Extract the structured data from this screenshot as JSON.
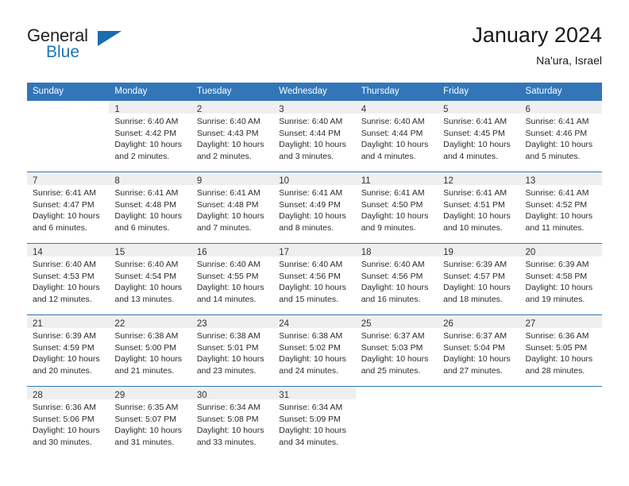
{
  "brand": {
    "name_part1": "General",
    "name_part2": "Blue",
    "flag_icon": "triangle-flag-icon"
  },
  "header": {
    "title": "January 2024",
    "location": "Na'ura, Israel"
  },
  "calendar": {
    "weekday_headers": [
      "Sunday",
      "Monday",
      "Tuesday",
      "Wednesday",
      "Thursday",
      "Friday",
      "Saturday"
    ],
    "header_bg": "#3276b8",
    "header_text_color": "#ffffff",
    "daynum_band_bg": "#efefef",
    "row_divider_color": "#3276b8",
    "weeks": [
      [
        {
          "day": "",
          "lines": []
        },
        {
          "day": "1",
          "lines": [
            "Sunrise: 6:40 AM",
            "Sunset: 4:42 PM",
            "Daylight: 10 hours",
            "and 2 minutes."
          ]
        },
        {
          "day": "2",
          "lines": [
            "Sunrise: 6:40 AM",
            "Sunset: 4:43 PM",
            "Daylight: 10 hours",
            "and 2 minutes."
          ]
        },
        {
          "day": "3",
          "lines": [
            "Sunrise: 6:40 AM",
            "Sunset: 4:44 PM",
            "Daylight: 10 hours",
            "and 3 minutes."
          ]
        },
        {
          "day": "4",
          "lines": [
            "Sunrise: 6:40 AM",
            "Sunset: 4:44 PM",
            "Daylight: 10 hours",
            "and 4 minutes."
          ]
        },
        {
          "day": "5",
          "lines": [
            "Sunrise: 6:41 AM",
            "Sunset: 4:45 PM",
            "Daylight: 10 hours",
            "and 4 minutes."
          ]
        },
        {
          "day": "6",
          "lines": [
            "Sunrise: 6:41 AM",
            "Sunset: 4:46 PM",
            "Daylight: 10 hours",
            "and 5 minutes."
          ]
        }
      ],
      [
        {
          "day": "7",
          "lines": [
            "Sunrise: 6:41 AM",
            "Sunset: 4:47 PM",
            "Daylight: 10 hours",
            "and 6 minutes."
          ]
        },
        {
          "day": "8",
          "lines": [
            "Sunrise: 6:41 AM",
            "Sunset: 4:48 PM",
            "Daylight: 10 hours",
            "and 6 minutes."
          ]
        },
        {
          "day": "9",
          "lines": [
            "Sunrise: 6:41 AM",
            "Sunset: 4:48 PM",
            "Daylight: 10 hours",
            "and 7 minutes."
          ]
        },
        {
          "day": "10",
          "lines": [
            "Sunrise: 6:41 AM",
            "Sunset: 4:49 PM",
            "Daylight: 10 hours",
            "and 8 minutes."
          ]
        },
        {
          "day": "11",
          "lines": [
            "Sunrise: 6:41 AM",
            "Sunset: 4:50 PM",
            "Daylight: 10 hours",
            "and 9 minutes."
          ]
        },
        {
          "day": "12",
          "lines": [
            "Sunrise: 6:41 AM",
            "Sunset: 4:51 PM",
            "Daylight: 10 hours",
            "and 10 minutes."
          ]
        },
        {
          "day": "13",
          "lines": [
            "Sunrise: 6:41 AM",
            "Sunset: 4:52 PM",
            "Daylight: 10 hours",
            "and 11 minutes."
          ]
        }
      ],
      [
        {
          "day": "14",
          "lines": [
            "Sunrise: 6:40 AM",
            "Sunset: 4:53 PM",
            "Daylight: 10 hours",
            "and 12 minutes."
          ]
        },
        {
          "day": "15",
          "lines": [
            "Sunrise: 6:40 AM",
            "Sunset: 4:54 PM",
            "Daylight: 10 hours",
            "and 13 minutes."
          ]
        },
        {
          "day": "16",
          "lines": [
            "Sunrise: 6:40 AM",
            "Sunset: 4:55 PM",
            "Daylight: 10 hours",
            "and 14 minutes."
          ]
        },
        {
          "day": "17",
          "lines": [
            "Sunrise: 6:40 AM",
            "Sunset: 4:56 PM",
            "Daylight: 10 hours",
            "and 15 minutes."
          ]
        },
        {
          "day": "18",
          "lines": [
            "Sunrise: 6:40 AM",
            "Sunset: 4:56 PM",
            "Daylight: 10 hours",
            "and 16 minutes."
          ]
        },
        {
          "day": "19",
          "lines": [
            "Sunrise: 6:39 AM",
            "Sunset: 4:57 PM",
            "Daylight: 10 hours",
            "and 18 minutes."
          ]
        },
        {
          "day": "20",
          "lines": [
            "Sunrise: 6:39 AM",
            "Sunset: 4:58 PM",
            "Daylight: 10 hours",
            "and 19 minutes."
          ]
        }
      ],
      [
        {
          "day": "21",
          "lines": [
            "Sunrise: 6:39 AM",
            "Sunset: 4:59 PM",
            "Daylight: 10 hours",
            "and 20 minutes."
          ]
        },
        {
          "day": "22",
          "lines": [
            "Sunrise: 6:38 AM",
            "Sunset: 5:00 PM",
            "Daylight: 10 hours",
            "and 21 minutes."
          ]
        },
        {
          "day": "23",
          "lines": [
            "Sunrise: 6:38 AM",
            "Sunset: 5:01 PM",
            "Daylight: 10 hours",
            "and 23 minutes."
          ]
        },
        {
          "day": "24",
          "lines": [
            "Sunrise: 6:38 AM",
            "Sunset: 5:02 PM",
            "Daylight: 10 hours",
            "and 24 minutes."
          ]
        },
        {
          "day": "25",
          "lines": [
            "Sunrise: 6:37 AM",
            "Sunset: 5:03 PM",
            "Daylight: 10 hours",
            "and 25 minutes."
          ]
        },
        {
          "day": "26",
          "lines": [
            "Sunrise: 6:37 AM",
            "Sunset: 5:04 PM",
            "Daylight: 10 hours",
            "and 27 minutes."
          ]
        },
        {
          "day": "27",
          "lines": [
            "Sunrise: 6:36 AM",
            "Sunset: 5:05 PM",
            "Daylight: 10 hours",
            "and 28 minutes."
          ]
        }
      ],
      [
        {
          "day": "28",
          "lines": [
            "Sunrise: 6:36 AM",
            "Sunset: 5:06 PM",
            "Daylight: 10 hours",
            "and 30 minutes."
          ]
        },
        {
          "day": "29",
          "lines": [
            "Sunrise: 6:35 AM",
            "Sunset: 5:07 PM",
            "Daylight: 10 hours",
            "and 31 minutes."
          ]
        },
        {
          "day": "30",
          "lines": [
            "Sunrise: 6:34 AM",
            "Sunset: 5:08 PM",
            "Daylight: 10 hours",
            "and 33 minutes."
          ]
        },
        {
          "day": "31",
          "lines": [
            "Sunrise: 6:34 AM",
            "Sunset: 5:09 PM",
            "Daylight: 10 hours",
            "and 34 minutes."
          ]
        },
        {
          "day": "",
          "lines": []
        },
        {
          "day": "",
          "lines": []
        },
        {
          "day": "",
          "lines": []
        }
      ]
    ]
  }
}
